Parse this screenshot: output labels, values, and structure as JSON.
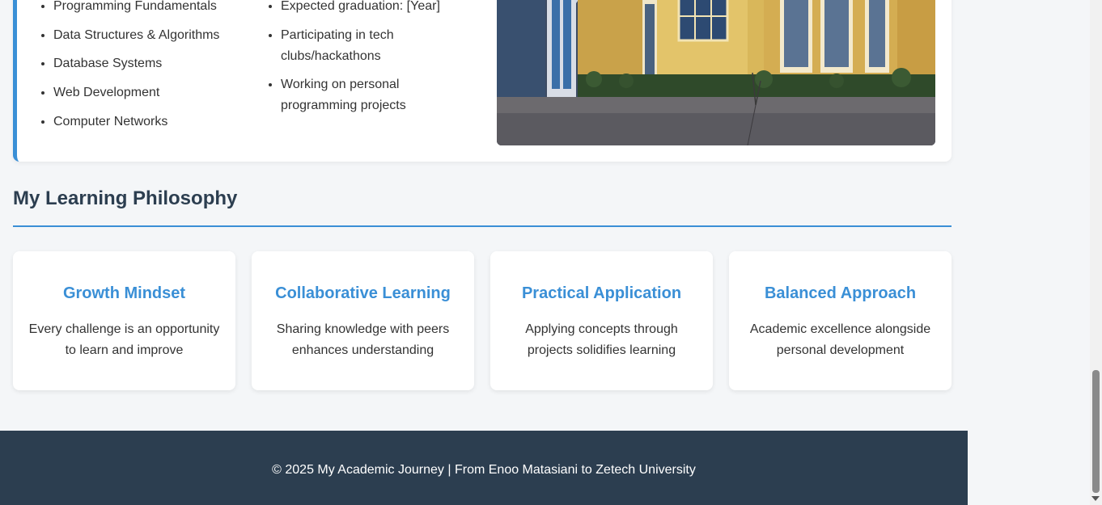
{
  "university_card": {
    "courses": [
      "Programming Fundamentals",
      "Data Structures & Algorithms",
      "Database Systems",
      "Web Development",
      "Computer Networks"
    ],
    "status": [
      "Expected graduation: [Year]",
      "Participating in tech clubs/hackathons",
      "Working on personal programming projects"
    ]
  },
  "philosophy": {
    "title": "My Learning Philosophy",
    "cards": [
      {
        "title": "Growth Mindset",
        "text": "Every challenge is an opportunity to learn and improve"
      },
      {
        "title": "Collaborative Learning",
        "text": "Sharing knowledge with peers enhances understanding"
      },
      {
        "title": "Practical Application",
        "text": "Applying concepts through projects solidifies learning"
      },
      {
        "title": "Balanced Approach",
        "text": "Academic excellence alongside personal development"
      }
    ]
  },
  "footer": {
    "text": "© 2025 My Academic Journey | From Enoo Matasiani to Zetech University"
  },
  "colors": {
    "accent": "#3a8fd6",
    "heading": "#2c3e50",
    "footer_bg": "#2c3e50"
  }
}
